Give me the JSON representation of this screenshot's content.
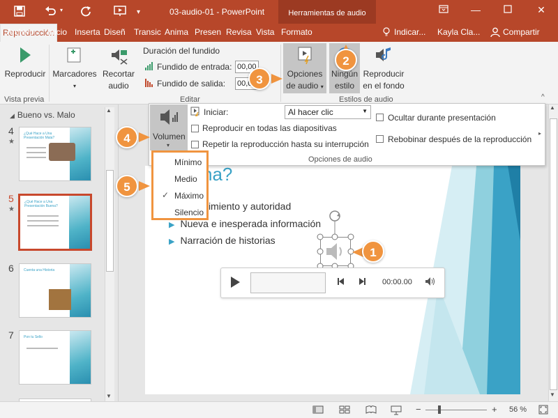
{
  "title_bar": {
    "doc_title": "03-audio-01  -  PowerPoint",
    "context_tools": "Herramientas de audio",
    "icons": [
      "save-icon",
      "undo-icon",
      "redo-icon",
      "present-icon",
      "ribbon-display-icon",
      "minimize-icon",
      "restore-icon",
      "close-icon"
    ]
  },
  "tabs": [
    "Archivo",
    "Inicio",
    "Inserta",
    "Diseñ",
    "Transic",
    "Anima",
    "Presen",
    "Revisa",
    "Vista",
    "Formato",
    "Reproducción"
  ],
  "tell_me": "Indicar...",
  "account": "Kayla Cla...",
  "share": "Compartir",
  "ribbon": {
    "play": "Reproducir",
    "bookmarks": "Marcadores",
    "trim_line1": "Recortar",
    "trim_line2": "audio",
    "fade_title": "Duración del fundido",
    "fade_in": "Fundido de entrada:",
    "fade_out": "Fundido de salida:",
    "fade_in_value": "00,00",
    "fade_out_value": "00,00",
    "audio_options_line1": "Opciones",
    "audio_options_line2": "de audio",
    "no_style_line1": "Ningún",
    "no_style_line2": "estilo",
    "play_bg_line1": "Reproducir",
    "play_bg_line2": "en el fondo",
    "group_preview": "Vista previa",
    "group_edit": "Editar",
    "group_styles": "Estilos de audio"
  },
  "audio_options": {
    "volume": "Volumen",
    "start_label": "Iniciar:",
    "start_value": "Al hacer clic",
    "all_slides": "Reproducir en todas las diapositivas",
    "loop": "Repetir la reproducción hasta su interrupción",
    "hide": "Ocultar durante presentación",
    "rewind": "Rebobinar después de la reproducción",
    "group_label": "Opciones de audio"
  },
  "volume_menu": {
    "items": [
      "Mínimo",
      "Medio",
      "Máximo",
      "Silencio"
    ],
    "checked": "Máximo"
  },
  "callouts": [
    "1",
    "2",
    "3",
    "4",
    "5"
  ],
  "thumbnails": {
    "section": "Bueno vs. Malo",
    "slides": [
      {
        "num": "4",
        "title": "¿Qué Hace a Una Presentación Mala?"
      },
      {
        "num": "5",
        "title": "¿Qué Hace a Una Presentación Buena?"
      },
      {
        "num": "6",
        "title": "Cuenta una Historia"
      },
      {
        "num": "7",
        "title": "Pon tu Sello"
      }
    ]
  },
  "slide": {
    "title_fragment": "na?",
    "bullets": [
      "Conocimiento y autoridad",
      "Nueva e inesperada información",
      "Narración de historias"
    ],
    "player_time": "00:00.00"
  },
  "status": {
    "zoom": "56 %"
  },
  "colors": {
    "brand": "#b7472a",
    "accent": "#f0943f",
    "slide_accent": "#3aa2c6"
  }
}
